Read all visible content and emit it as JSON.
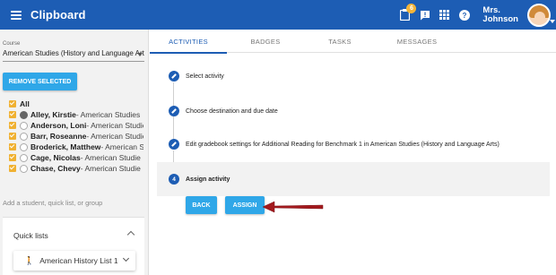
{
  "app": {
    "title": "Clipboard",
    "notification_count": "6",
    "user_line1": "Mrs.",
    "user_line2": "Johnson"
  },
  "icons": {
    "menu": "hamburger-menu-icon",
    "clipboard": "clipboard-icon",
    "message": "message-alert-icon",
    "apps": "apps-grid-icon",
    "help": "help-icon"
  },
  "sidebar": {
    "course_label": "Course",
    "course_value": "American Studies (History and Language Art...",
    "remove_button": "REMOVE SELECTED",
    "all_label": "All",
    "students": [
      {
        "name": "Alley, Kirstie",
        "course": " - American Studies"
      },
      {
        "name": "Anderson, Loni",
        "course": " - American Studie"
      },
      {
        "name": "Barr, Roseanne",
        "course": " - American Studie"
      },
      {
        "name": "Broderick, Matthew",
        "course": " - American S"
      },
      {
        "name": "Cage, Nicolas",
        "course": " - American Studie"
      },
      {
        "name": "Chase, Chevy",
        "course": " - American Studie"
      }
    ],
    "add_placeholder": "Add a student, quick list, or group",
    "quick_lists_title": "Quick lists",
    "quick_list_item": "American History List 1"
  },
  "tabs": [
    "ACTIVITIES",
    "BADGES",
    "TASKS",
    "MESSAGES"
  ],
  "steps": [
    {
      "label": "Select activity"
    },
    {
      "label": "Choose destination and due date"
    },
    {
      "label": "Edit gradebook settings for Additional Reading for Benchmark 1 in American Studies (History and Language Arts)"
    },
    {
      "number": "4",
      "label": "Assign activity"
    }
  ],
  "buttons": {
    "back": "BACK",
    "assign": "ASSIGN"
  },
  "colors": {
    "primary": "#1d5db4",
    "button": "#2fa7e8",
    "checkbox": "#f0b132",
    "badge": "#f2b43a",
    "arrow": "#a31a1e"
  }
}
